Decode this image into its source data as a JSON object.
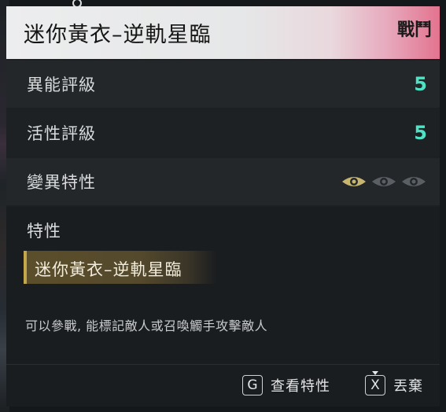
{
  "header": {
    "title": "迷你黃衣–逆軌星臨",
    "tag": "戰鬥"
  },
  "stats": [
    {
      "label": "異能評級",
      "value": "5"
    },
    {
      "label": "活性評級",
      "value": "5"
    },
    {
      "label": "變異特性",
      "value": ""
    }
  ],
  "mutation": {
    "levels": [
      {
        "name": "eye-icon",
        "active": true
      },
      {
        "name": "eye-icon",
        "active": false
      },
      {
        "name": "eye-icon",
        "active": false
      }
    ]
  },
  "traits": {
    "heading": "特性",
    "trait_name": "迷你黃衣–逆軌星臨",
    "description": "可以參戰, 能標記敵人或召喚觸手攻擊敵人"
  },
  "actions": [
    {
      "key": "G",
      "label": "查看特性"
    },
    {
      "key": "X",
      "label": "丟棄"
    }
  ],
  "colors": {
    "accent_value": "#4fe3c6",
    "eye_active": "#c7b570",
    "eye_inactive": "#5a5f63",
    "header_pink": "#e3738f"
  }
}
